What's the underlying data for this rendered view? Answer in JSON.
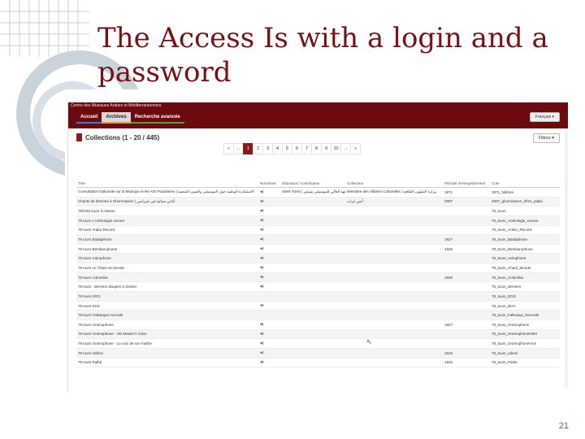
{
  "slide": {
    "title": "The Access Is with a login and a password",
    "page_number": "21",
    "accent_color": "#7a1015"
  },
  "site": {
    "title": "Centre des Musiques Arabes et Méditerranéennes",
    "nav": [
      {
        "label": "Accueil",
        "underline": "#3a7bd5",
        "active": false
      },
      {
        "label": "Archives",
        "underline": "#e0a020",
        "active": true
      },
      {
        "label": "Recherche avancée",
        "underline": "#5aa02c",
        "active": false
      }
    ],
    "language": "Français ▾",
    "header_color": "#6c0b0f"
  },
  "collections": {
    "title": "Collections (1 - 20 / 445)",
    "icon": "book-icon",
    "filter_label": "Filtres ▾",
    "pagination": [
      "«",
      "←",
      "1",
      "2",
      "3",
      "4",
      "5",
      "6",
      "7",
      "8",
      "9",
      "10",
      "→",
      "»"
    ],
    "active_page": "1"
  },
  "table": {
    "columns": [
      "Titre",
      "Numérisé",
      "Déposant / contributeur",
      "Collecteur",
      "Période d'enregistrement",
      "Cote"
    ],
    "rows": [
      {
        "title": "Consultation Nationale sur la Musique et les Arts Populaires | الاستشارة الوطنية حول الموسيقى والفنون الشعبية",
        "audio": true,
        "depositor": "ISMA Tunis | المعهد العالي للموسيقى بتونس",
        "collector": "Ministère des Affaires Culturelles | وزارة الشؤون الثقافية",
        "period": "1971",
        "code": "1971_folklore"
      },
      {
        "title": "Chants de femmes à Ghomrassen | أغاني نسائية في غمراسن",
        "audio": true,
        "depositor": "",
        "collector": "أنس غراب",
        "period": "2007",
        "code": "2007_ghomrassen_hfms_plaka"
      },
      {
        "title": "78/2/45 tours à classer",
        "audio": true,
        "depositor": "",
        "collector": "",
        "period": "",
        "code": "78_tours"
      },
      {
        "title": "78 tours L'Anthologie sonore",
        "audio": true,
        "depositor": "",
        "collector": "",
        "period": "",
        "code": "78_tours_Anthologie_sonore"
      },
      {
        "title": "78 tours Arabo Record",
        "audio": true,
        "depositor": "",
        "collector": "",
        "period": "",
        "code": "78_tours_Arabo_Record"
      },
      {
        "title": "78 tours Baidaphone",
        "audio": true,
        "depositor": "",
        "collector": "",
        "period": "1927",
        "code": "78_tours_Baidaphone"
      },
      {
        "title": "78 tours Bembarophone",
        "audio": true,
        "depositor": "",
        "collector": "",
        "period": "1926",
        "code": "78_tours_Bembarophone"
      },
      {
        "title": "78 tours Cairophone",
        "audio": true,
        "depositor": "",
        "collector": "",
        "period": "",
        "code": "78_tours_cairophone"
      },
      {
        "title": "78 tours Le Chant du Monde",
        "audio": true,
        "depositor": "",
        "collector": "",
        "period": "",
        "code": "78_tours_Chant_Monde"
      },
      {
        "title": "78 tours Columbia",
        "audio": true,
        "depositor": "",
        "collector": "",
        "period": "1926",
        "code": "78_tours_Columbia"
      },
      {
        "title": "78 tours : derniers disques à classer",
        "audio": true,
        "depositor": "",
        "collector": "",
        "period": "",
        "code": "78_tours_derniers"
      },
      {
        "title": "78 tours DGG",
        "audio": false,
        "depositor": "",
        "collector": "",
        "period": "",
        "code": "78_tours_DGG"
      },
      {
        "title": "78 tours DHV",
        "audio": true,
        "depositor": "",
        "collector": "",
        "period": "",
        "code": "78_tours_DHV"
      },
      {
        "title": "78 tours Falkwayes records",
        "audio": false,
        "depositor": "",
        "collector": "",
        "period": "",
        "code": "78_tours_Falkways_Records"
      },
      {
        "title": "78 tours Gramophone",
        "audio": true,
        "depositor": "",
        "collector": "",
        "period": "1927",
        "code": "78_tours_Gramophone"
      },
      {
        "title": "78 tours Gramophone - His Master's Voice",
        "audio": true,
        "depositor": "",
        "collector": "",
        "period": "",
        "code": "78_tours_GramophoneHMV"
      },
      {
        "title": "78 tours Gramophone - La voix de son maître",
        "audio": true,
        "depositor": "",
        "collector": "",
        "period": "",
        "code": "78_tours_GramophoneVsm"
      },
      {
        "title": "78 tours Odéon",
        "audio": true,
        "depositor": "",
        "collector": "",
        "period": "1915",
        "code": "78_tours_odeon"
      },
      {
        "title": "78 tours Pathé",
        "audio": true,
        "depositor": "",
        "collector": "",
        "period": "1926",
        "code": "78_tours_Pathe"
      }
    ]
  }
}
